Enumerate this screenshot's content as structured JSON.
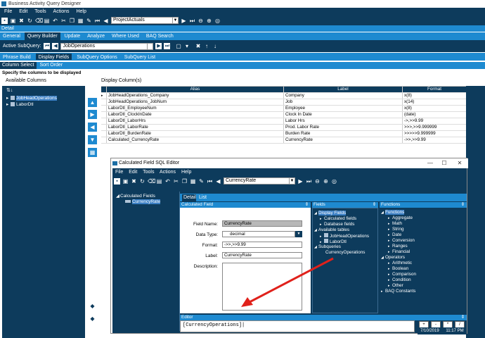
{
  "app": {
    "title": "Business Activity Query Designer"
  },
  "menu": [
    "File",
    "Edit",
    "Tools",
    "Actions",
    "Help"
  ],
  "toolbar": {
    "query_name": "ProjectActuals"
  },
  "section_label": "Detail",
  "main_tabs": [
    "General",
    "Query Builder",
    "Update",
    "Analyze",
    "Where Used",
    "BAQ Search"
  ],
  "subquery": {
    "label": "Active SubQuery:",
    "value": "JobOperations"
  },
  "sub_tabs": [
    "Phrase Build",
    "Display Fields",
    "SubQuery Options",
    "SubQuery List"
  ],
  "inner_tabs": [
    "Column Select",
    "Sort Order"
  ],
  "instruction": "Specify the columns to be displayed",
  "available_columns": {
    "label": "Available Columns",
    "items": [
      "JobHeadOperations",
      "LaborDtl"
    ]
  },
  "display_columns": {
    "label": "Display Column(s)",
    "headers": [
      "Alias",
      "Label",
      "Format"
    ],
    "rows": [
      [
        "JobHeadOperations_Company",
        "Company",
        "x(8)"
      ],
      [
        "JobHeadOperations_JobNum",
        "Job",
        "x(14)"
      ],
      [
        "LaborDtl_EmployeeNum",
        "Employee",
        "x(8)"
      ],
      [
        "LaborDtl_ClockInDate",
        "Clock In Date",
        "(date)"
      ],
      [
        "LaborDtl_LaborHrs",
        "Labor Hrs",
        "->,>>9.99"
      ],
      [
        "LaborDtl_LaborRate",
        "Prod. Labor Rate",
        ">>>,>>9.999999"
      ],
      [
        "LaborDtl_BurdenRate",
        "Burden Rate",
        ">>>>>9.999999"
      ],
      [
        "Calculated_CurrencyRate",
        "CurrencyRate",
        "->>,>>9.99"
      ]
    ]
  },
  "dialog": {
    "title": "Calculated Field SQL Editor",
    "menu": [
      "File",
      "Edit",
      "Tools",
      "Actions",
      "Help"
    ],
    "toolbar_value": "CurrencyRate",
    "tree": {
      "root": "Calculated Fields",
      "child": "CurrencyRate"
    },
    "tabs": [
      "Detail",
      "List"
    ],
    "calc_panel_title": "Calculated Field",
    "fields_panel_title": "Fields",
    "functions_panel_title": "Functions",
    "form": {
      "field_name_label": "Field Name:",
      "field_name": "CurrencyRate",
      "data_type_label": "Data Type:",
      "data_type": "decimal",
      "format_label": "Format:",
      "format": "->>,>>9.99",
      "label_label": "Label:",
      "label": "CurrencyRate",
      "description_label": "Description:"
    },
    "fields_tree": [
      "Display Fields",
      "Calculated fields",
      "Database fields",
      "Available tables",
      "JobHeadOperations",
      "LaborDtl",
      "Subqueries",
      "CurrencyOperations"
    ],
    "functions_tree": [
      "Functions",
      "Aggregate",
      "Math",
      "String",
      "Date",
      "Conversion",
      "Ranges",
      "Financial",
      "Operators",
      "Arithmetic",
      "Boolean",
      "Comparison",
      "Condition",
      "Other",
      "BAQ Constants"
    ],
    "editor_title": "Editor",
    "editor_text": "[CurrencyOperations]",
    "status_date": "7/10/2019",
    "status_time": "11:17 PM"
  }
}
